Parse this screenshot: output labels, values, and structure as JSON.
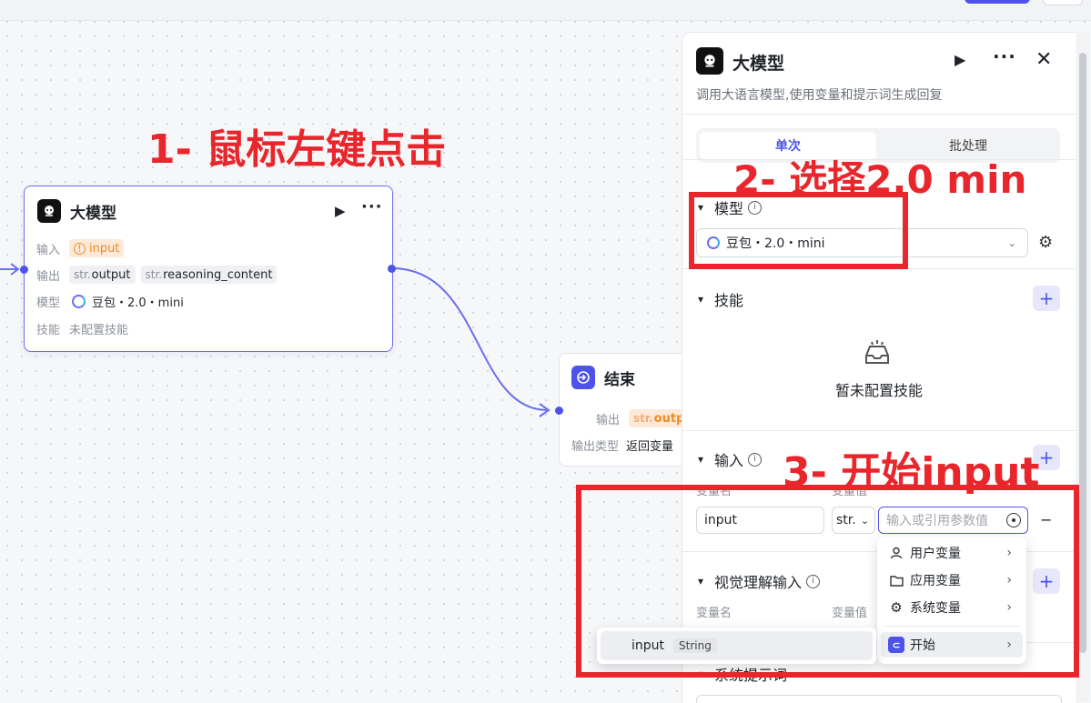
{
  "annotations": {
    "step1": "1- 鼠标左键点击",
    "step2": "2- 选择2.0 min",
    "step3": "3- 开始input"
  },
  "llm_node": {
    "title": "大模型",
    "input_label": "输入",
    "input_tag": "input",
    "output_label": "输出",
    "outputs": [
      {
        "type": "str.",
        "name": "output"
      },
      {
        "type": "str.",
        "name": "reasoning_content"
      }
    ],
    "model_label": "模型",
    "model_value": "豆包・2.0・mini",
    "skill_label": "技能",
    "skill_value": "未配置技能"
  },
  "end_node": {
    "title": "结束",
    "output_label": "输出",
    "output_type": "str.",
    "output_tag": "outpu",
    "output_kind_label": "输出类型",
    "output_kind_value": "返回变量"
  },
  "panel": {
    "title": "大模型",
    "description": "调用大语言模型,使用变量和提示词生成回复",
    "tabs": [
      {
        "label": "单次",
        "active": true
      },
      {
        "label": "批处理",
        "active": false
      }
    ],
    "model": {
      "section_title": "模型",
      "selected": "豆包・2.0・mini"
    },
    "skills": {
      "section_title": "技能",
      "empty_text": "暂未配置技能"
    },
    "input": {
      "section_title": "输入",
      "col_name": "变量名",
      "col_value": "变量值",
      "var_name": "input",
      "var_type": "str.",
      "value_placeholder": "输入或引用参数值"
    },
    "vision": {
      "section_title": "视觉理解输入",
      "col_name": "变量名",
      "col_value": "变量值"
    },
    "system_prompt": {
      "section_title": "系统提示词"
    }
  },
  "dropdown": {
    "items": [
      {
        "label": "用户变量",
        "icon": "user-icon"
      },
      {
        "label": "应用变量",
        "icon": "folder-icon"
      },
      {
        "label": "系统变量",
        "icon": "gear-icon"
      },
      {
        "label": "开始",
        "icon": "start-node-icon"
      }
    ],
    "submenu": {
      "name": "input",
      "type": "String"
    }
  },
  "colors": {
    "accent": "#4d53e8",
    "annotation": "#e8262b",
    "warning": "#f08a24"
  }
}
